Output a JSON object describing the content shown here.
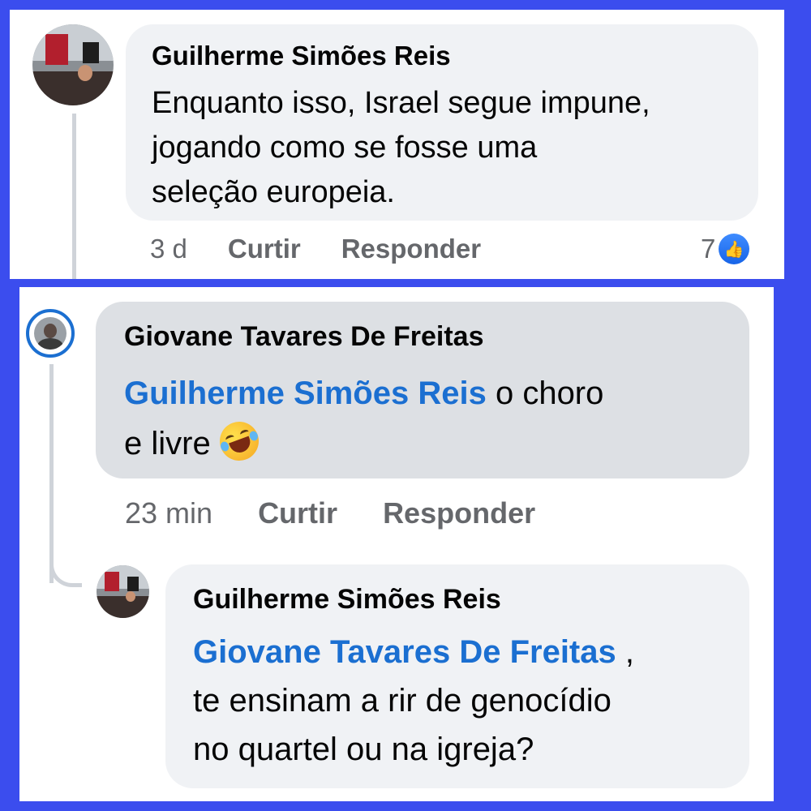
{
  "comments": [
    {
      "author": "Guilherme Simões Reis",
      "text_lines": [
        "Enquanto isso, Israel segue impune,",
        "jogando como se fosse uma",
        "seleção europeia."
      ],
      "time": "3 d",
      "like_label": "Curtir",
      "reply_label": "Responder",
      "reaction_count": "7",
      "reaction_icon": "thumbs-up-icon"
    },
    {
      "author": "Giovane Tavares De Freitas",
      "mention": "Guilherme Simões Reis",
      "text_after_mention": " o choro",
      "text_line2": "e livre ",
      "emoji": "rolling-on-floor-laughing-emoji",
      "time": "23 min",
      "like_label": "Curtir",
      "reply_label": "Responder"
    },
    {
      "author": "Guilherme Simões Reis",
      "mention": "Giovane Tavares De Freitas",
      "text_after_mention": " ,",
      "text_lines": [
        "te ensinam a rir de genocídio",
        "no quartel ou na igreja?"
      ]
    }
  ],
  "colors": {
    "frame": "#3b4dee",
    "mention": "#1b6fd1",
    "bubble": "#f0f2f5",
    "bubble_highlight": "#dde0e4",
    "like_badge": "#1764e8"
  }
}
